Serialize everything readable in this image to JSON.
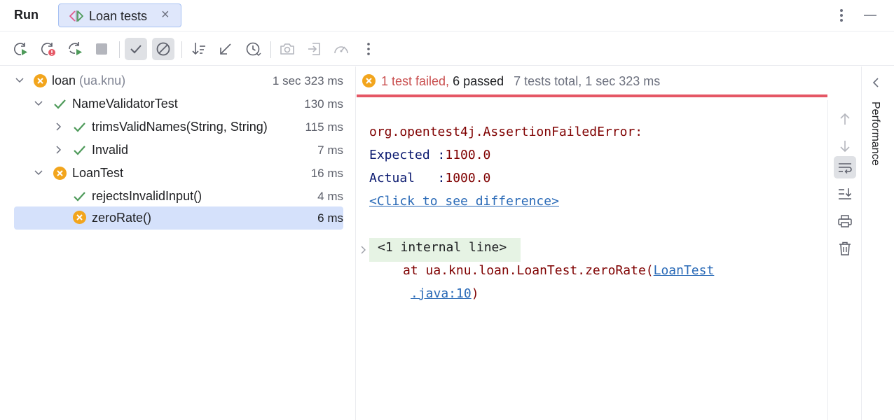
{
  "header": {
    "title": "Run",
    "tab": {
      "label": "Loan tests",
      "close": "×"
    }
  },
  "toolbar": {
    "buttons": [
      "rerun-icon",
      "rerun-failed-icon",
      "toggle-auto-test-icon",
      "stop-icon",
      "show-passed-icon",
      "show-ignored-icon",
      "sort-icon",
      "collapse-icon",
      "history-icon",
      "camera-icon",
      "import-icon",
      "performance-gauge-icon",
      "more-icon"
    ]
  },
  "tree": {
    "rows": [
      {
        "label": "loan",
        "sub": "(ua.knu)",
        "time": "1 sec 323 ms",
        "status": "failed"
      },
      {
        "label": "NameValidatorTest",
        "time": "130 ms",
        "status": "passed"
      },
      {
        "label": "trimsValidNames(String, String)",
        "time": "115 ms",
        "status": "passed"
      },
      {
        "label": "Invalid",
        "time": "7 ms",
        "status": "passed"
      },
      {
        "label": "LoanTest",
        "time": "16 ms",
        "status": "failed"
      },
      {
        "label": "rejectsInvalidInput()",
        "time": "4 ms",
        "status": "passed"
      },
      {
        "label": "zeroRate()",
        "time": "6 ms",
        "status": "failed"
      }
    ]
  },
  "summary": {
    "failed": "1 test failed,",
    "passed": "6 passed",
    "total": "7 tests total, 1 sec 323 ms"
  },
  "console": {
    "error_class": "org.opentest4j.AssertionFailedError:",
    "expected_key": "Expected :",
    "expected_value": "1100.0",
    "actual_key": "Actual   :",
    "actual_value": "1000.0",
    "diff_link": "<Click to see difference>",
    "internal_line": "<1 internal line>",
    "at_prefix": "at ua.knu.loan.LoanTest.zeroRate(",
    "file_link_1": "LoanTest",
    "file_link_2": ".java:10",
    "close_paren": ")"
  },
  "side": {
    "label": "Performance"
  },
  "colors": {
    "failed": "#c94f4f",
    "passed": "#4e9a5a",
    "warn": "#f2a51d",
    "selection": "#d5e1fb",
    "link": "#2a6ab7"
  }
}
